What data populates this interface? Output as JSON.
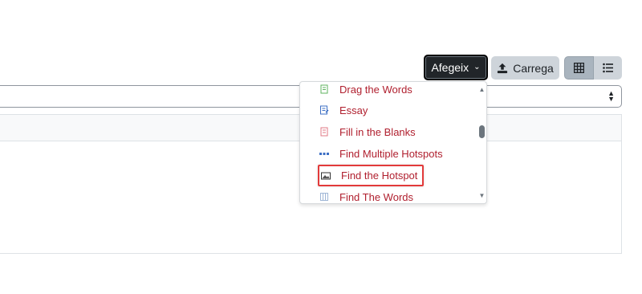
{
  "toolbar": {
    "add_label": "Afegeix",
    "upload_label": "Carrega"
  },
  "dropdown": {
    "items": [
      {
        "label": "Drag the Words",
        "icon": "drag-the-words-icon"
      },
      {
        "label": "Essay",
        "icon": "essay-icon"
      },
      {
        "label": "Fill in the Blanks",
        "icon": "fill-in-the-blanks-icon"
      },
      {
        "label": "Find Multiple Hotspots",
        "icon": "find-multiple-hotspots-icon"
      },
      {
        "label": "Find the Hotspot",
        "icon": "find-the-hotspot-icon"
      },
      {
        "label": "Find The Words",
        "icon": "find-the-words-icon"
      }
    ],
    "highlighted_item": "Find the Hotspot"
  },
  "colors": {
    "add_button_bg": "#212529",
    "item_text": "#b01f2e",
    "highlight_border": "#e23a3a"
  }
}
